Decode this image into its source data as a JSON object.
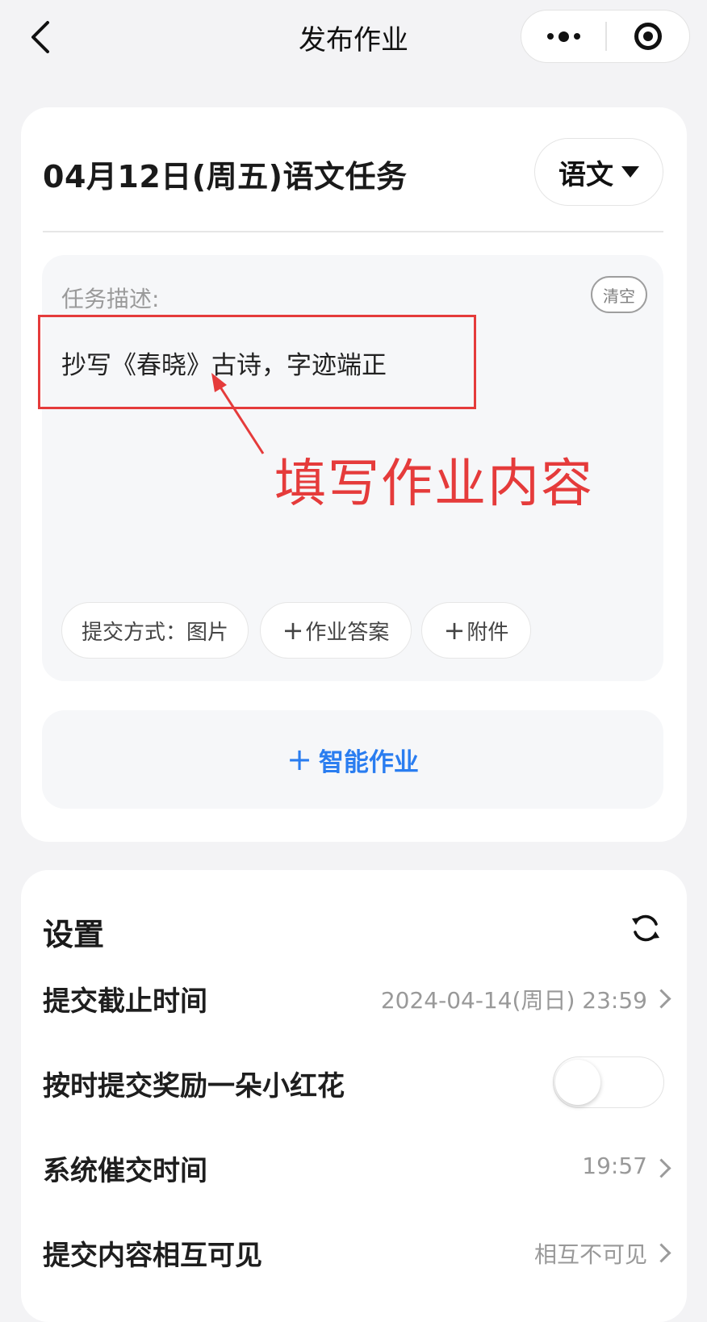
{
  "nav": {
    "title": "发布作业",
    "back_icon": "chevron-left-icon",
    "more_icon": "more-dots-icon",
    "close_icon": "record-circle-icon"
  },
  "task": {
    "title": "04月12日(周五)语文任务",
    "subject": "语文",
    "description_label": "任务描述:",
    "clear_label": "清空",
    "description": "抄写《春晓》古诗，字迹端正",
    "chips": {
      "submit_method": "提交方式：图片",
      "answer": "作业答案",
      "attachment": "附件"
    },
    "smart_homework": "智能作业"
  },
  "annotation": {
    "text": "填写作业内容",
    "color": "#e53b3b"
  },
  "settings": {
    "title": "设置",
    "rows": [
      {
        "label": "提交截止时间",
        "value": "2024-04-14(周日) 23:59"
      },
      {
        "label": "按时提交奖励一朵小红花",
        "toggle": false
      },
      {
        "label": "系统催交时间",
        "value": "19:57"
      },
      {
        "label": "提交内容相互可见",
        "value": "相互不可见"
      }
    ]
  },
  "colors": {
    "accent": "#2a7df0",
    "background": "#f3f3f5"
  }
}
